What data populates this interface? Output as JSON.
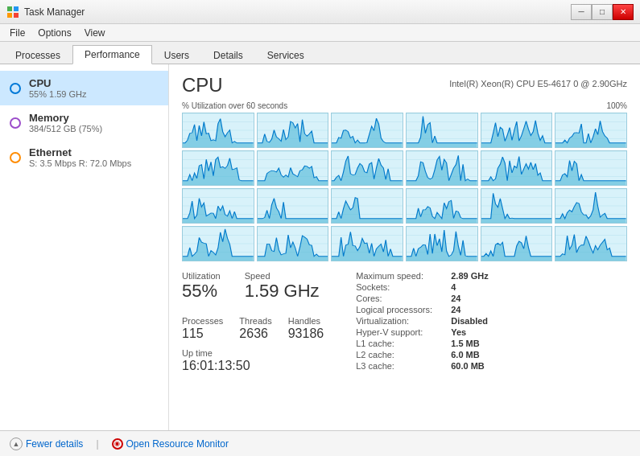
{
  "titlebar": {
    "title": "Task Manager",
    "minimize": "─",
    "maximize": "□",
    "close": "✕"
  },
  "menu": {
    "items": [
      "File",
      "Options",
      "View"
    ]
  },
  "tabs": {
    "items": [
      "Processes",
      "Performance",
      "Users",
      "Details",
      "Services"
    ],
    "active": "Performance"
  },
  "sidebar": {
    "items": [
      {
        "id": "cpu",
        "name": "CPU",
        "detail": "55%  1.59 GHz",
        "type": "cpu"
      },
      {
        "id": "memory",
        "name": "Memory",
        "detail": "384/512 GB (75%)",
        "type": "memory"
      },
      {
        "id": "ethernet",
        "name": "Ethernet",
        "detail": "S: 3.5 Mbps  R: 72.0 Mbps",
        "type": "ethernet"
      }
    ]
  },
  "content": {
    "title": "CPU",
    "cpu_model": "Intel(R) Xeon(R) CPU E5-4617 0 @ 2.90GHz",
    "graphs_label": "% Utilization over 60 seconds",
    "graphs_right_label": "100%",
    "stats": {
      "utilization_label": "Utilization",
      "utilization_value": "55%",
      "speed_label": "Speed",
      "speed_value": "1.59 GHz",
      "processes_label": "Processes",
      "processes_value": "115",
      "threads_label": "Threads",
      "threads_value": "2636",
      "handles_label": "Handles",
      "handles_value": "93186",
      "uptime_label": "Up time",
      "uptime_value": "16:01:13:50"
    },
    "right_stats": [
      {
        "label": "Maximum speed:",
        "value": "2.89 GHz",
        "bold": false
      },
      {
        "label": "Sockets:",
        "value": "4",
        "bold": false
      },
      {
        "label": "Cores:",
        "value": "24",
        "bold": false
      },
      {
        "label": "Logical processors:",
        "value": "24",
        "bold": false
      },
      {
        "label": "Virtualization:",
        "value": "Disabled",
        "bold": true
      },
      {
        "label": "Hyper-V support:",
        "value": "Yes",
        "bold": false
      },
      {
        "label": "L1 cache:",
        "value": "1.5 MB",
        "bold": false
      },
      {
        "label": "L2 cache:",
        "value": "6.0 MB",
        "bold": false
      },
      {
        "label": "L3 cache:",
        "value": "60.0 MB",
        "bold": false
      }
    ]
  },
  "bottom": {
    "fewer_details": "Fewer details",
    "open_resource_monitor": "Open Resource Monitor"
  }
}
